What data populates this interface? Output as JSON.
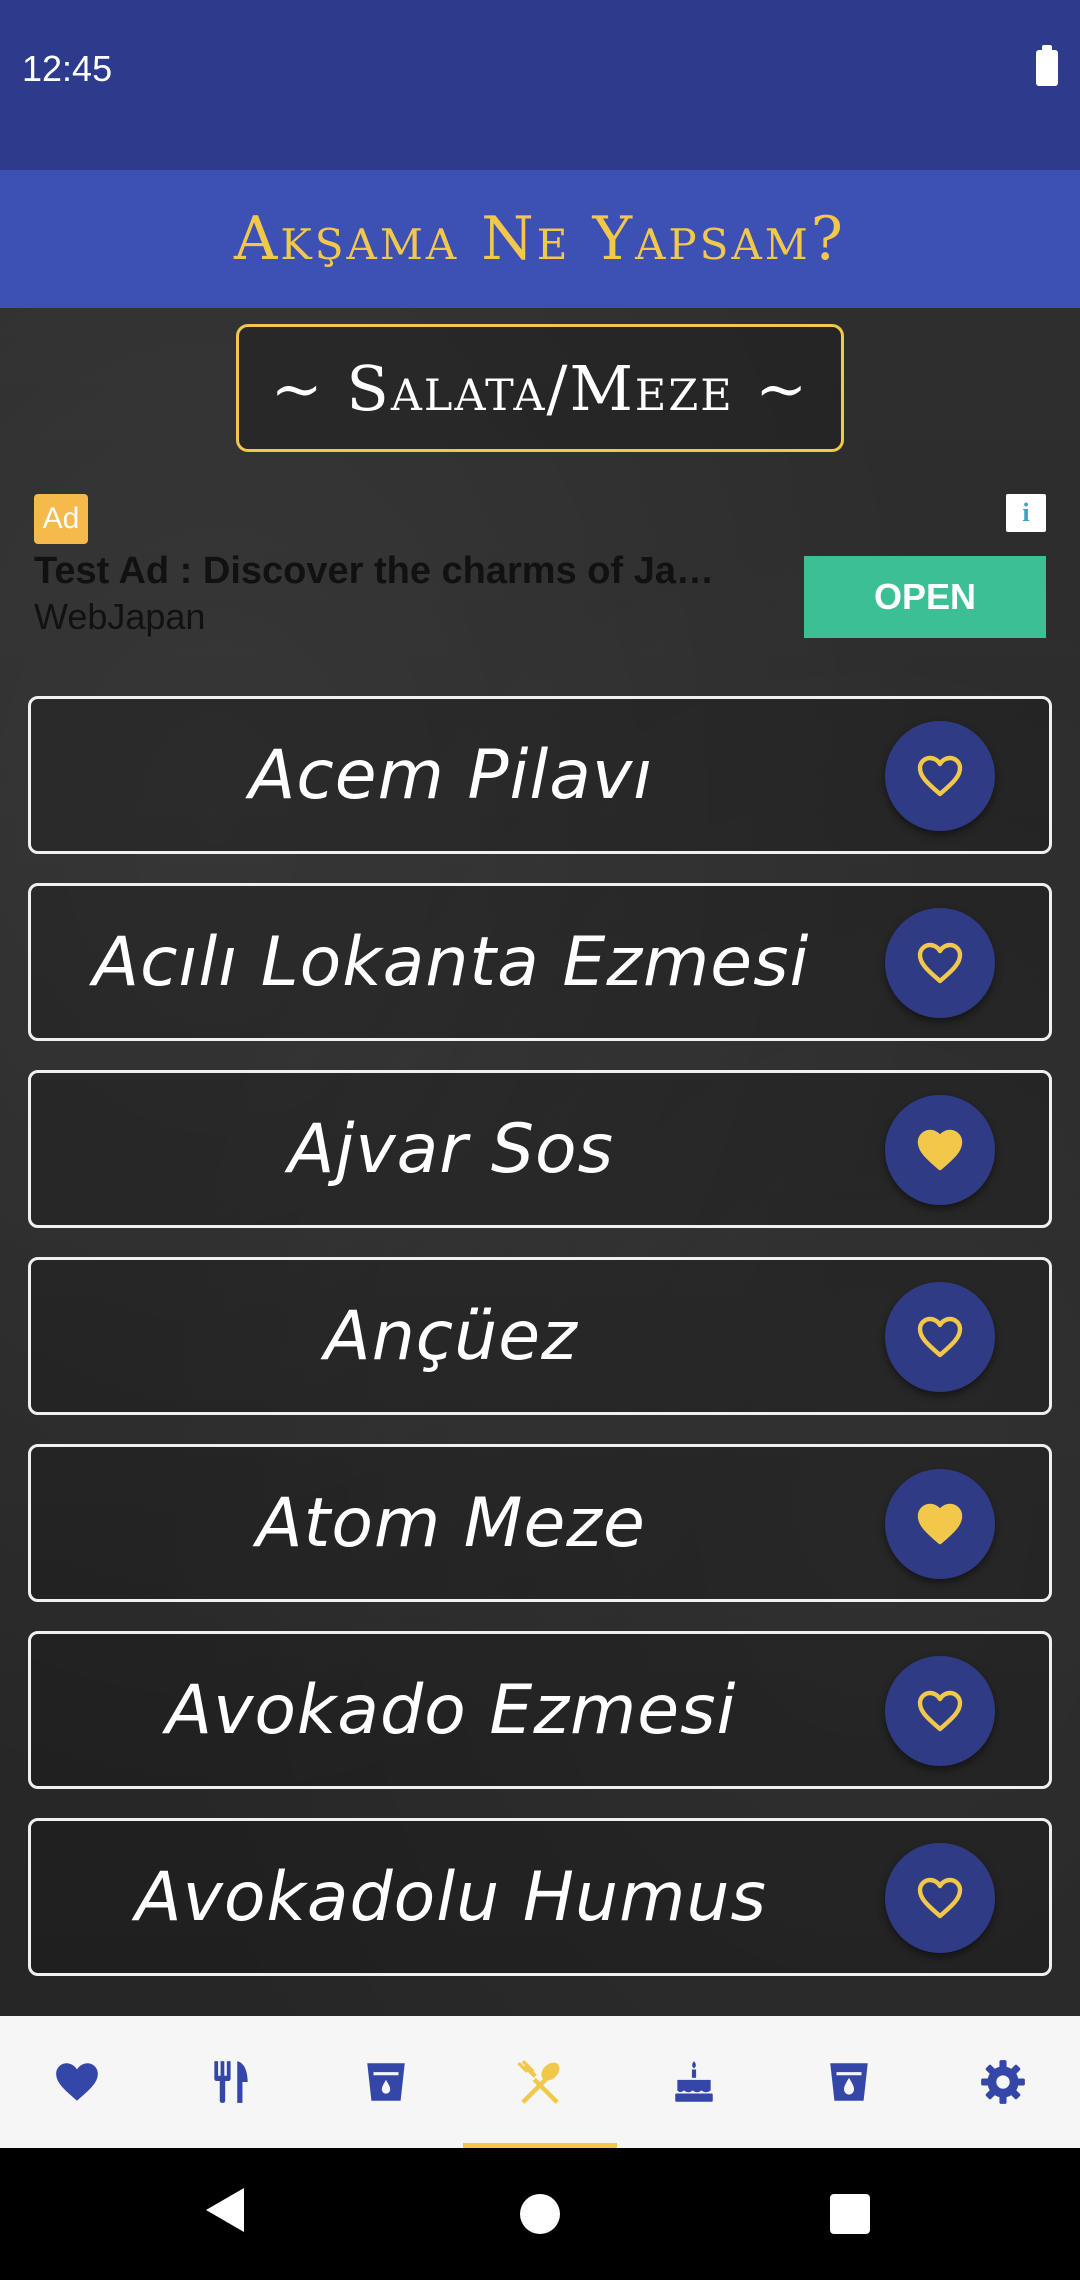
{
  "status_bar": {
    "time": "12:45"
  },
  "app_bar": {
    "title": "Akşama Ne Yapsam?"
  },
  "category": {
    "label": "~ Salata/Meze ~"
  },
  "ad": {
    "badge": "Ad",
    "info": "i",
    "headline": "Test Ad : Discover the charms of Ja…",
    "advertiser": "WebJapan",
    "cta": "OPEN"
  },
  "colors": {
    "primary_dark": "#2c3b8c",
    "primary": "#3d51b4",
    "accent": "#f2c84b",
    "fav_button": "#2f3b85",
    "ad_cta": "#3dbf95"
  },
  "recipes": [
    {
      "name": "Acem Pilavı",
      "favorite": false
    },
    {
      "name": "Acılı Lokanta Ezmesi",
      "favorite": false
    },
    {
      "name": "Ajvar Sos",
      "favorite": true
    },
    {
      "name": "Ançüez",
      "favorite": false
    },
    {
      "name": "Atom Meze",
      "favorite": true
    },
    {
      "name": "Avokado Ezmesi",
      "favorite": false
    },
    {
      "name": "Avokadolu Humus",
      "favorite": false
    }
  ],
  "bottom_nav": [
    {
      "icon": "heart-icon",
      "active": false
    },
    {
      "icon": "fork-knife-icon",
      "active": false
    },
    {
      "icon": "cup-icon",
      "active": false
    },
    {
      "icon": "spoon-fork-cross-icon",
      "active": true
    },
    {
      "icon": "cake-icon",
      "active": false
    },
    {
      "icon": "glass-drop-icon",
      "active": false
    },
    {
      "icon": "gear-icon",
      "active": false
    }
  ]
}
